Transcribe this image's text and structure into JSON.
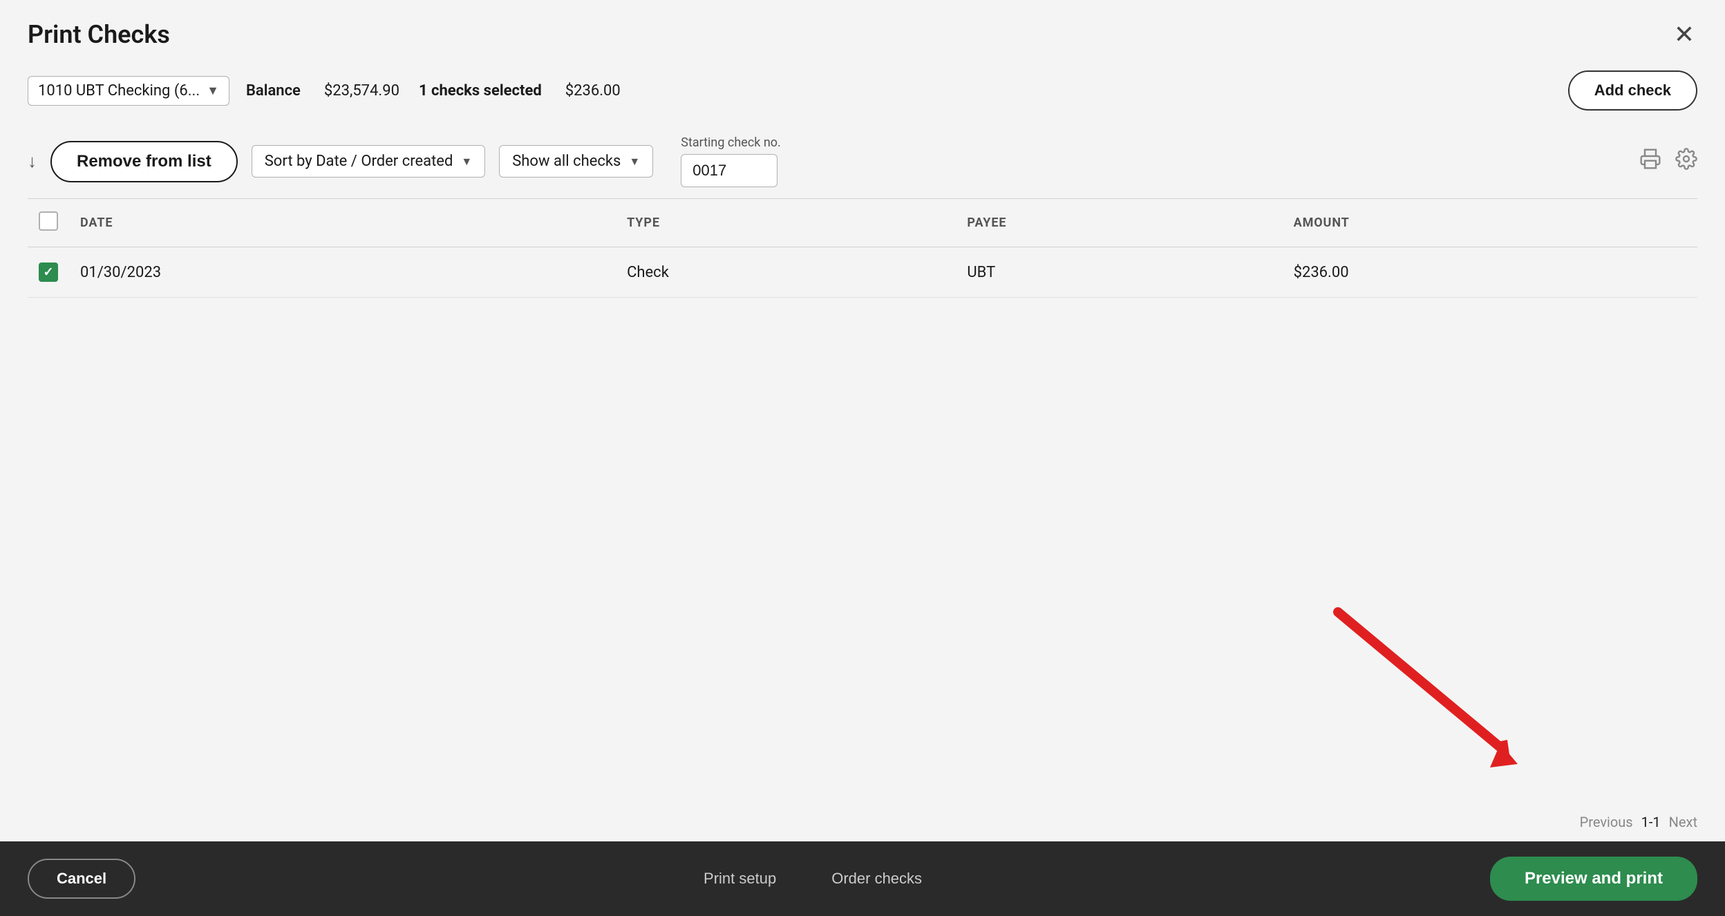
{
  "title": "Print Checks",
  "close_label": "✕",
  "account": {
    "label": "1010 UBT Checking (6...",
    "balance_label": "Balance",
    "balance_value": "$23,574.90",
    "checks_selected_label": "1 checks selected",
    "checks_selected_amount": "$236.00"
  },
  "add_check_label": "Add check",
  "toolbar": {
    "remove_label": "Remove from list",
    "sort_label": "Sort by Date / Order created",
    "filter_label": "Show all checks",
    "starting_check_label": "Starting check no.",
    "starting_check_value": "0017"
  },
  "table": {
    "columns": [
      "DATE",
      "TYPE",
      "PAYEE",
      "AMOUNT"
    ],
    "rows": [
      {
        "checked": true,
        "date": "01/30/2023",
        "type": "Check",
        "payee": "UBT",
        "amount": "$236.00"
      }
    ]
  },
  "pagination": {
    "previous": "Previous",
    "range": "1-1",
    "next": "Next"
  },
  "footer": {
    "cancel_label": "Cancel",
    "print_setup_label": "Print setup",
    "order_checks_label": "Order checks",
    "preview_print_label": "Preview and print"
  }
}
